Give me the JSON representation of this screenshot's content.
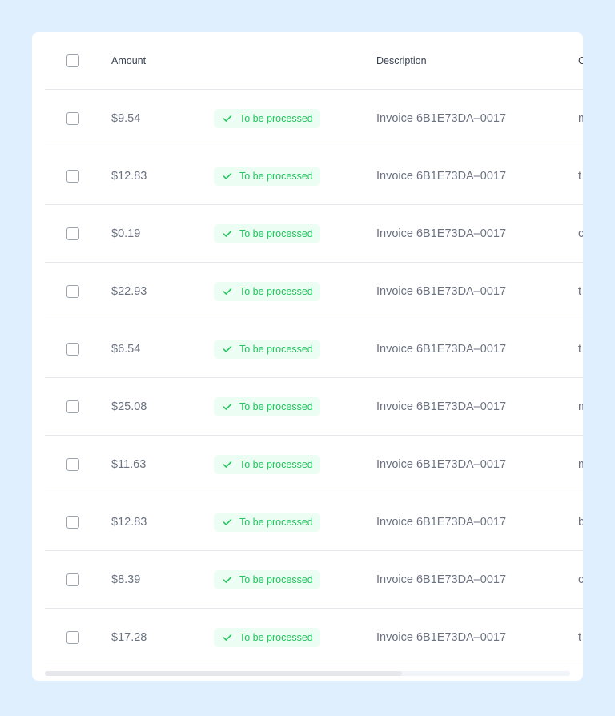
{
  "table": {
    "columns": {
      "amount": "Amount",
      "status": "",
      "description": "Description",
      "extra": "C"
    },
    "rows": [
      {
        "amount": "$9.54",
        "status": "To be processed",
        "description": "Invoice 6B1E73DA–0017",
        "extra": "m"
      },
      {
        "amount": "$12.83",
        "status": "To be processed",
        "description": "Invoice 6B1E73DA–0017",
        "extra": "t"
      },
      {
        "amount": "$0.19",
        "status": "To be processed",
        "description": "Invoice 6B1E73DA–0017",
        "extra": "c"
      },
      {
        "amount": "$22.93",
        "status": "To be processed",
        "description": "Invoice 6B1E73DA–0017",
        "extra": "t"
      },
      {
        "amount": "$6.54",
        "status": "To be processed",
        "description": "Invoice 6B1E73DA–0017",
        "extra": "t"
      },
      {
        "amount": "$25.08",
        "status": "To be processed",
        "description": "Invoice 6B1E73DA–0017",
        "extra": "m"
      },
      {
        "amount": "$11.63",
        "status": "To be processed",
        "description": "Invoice 6B1E73DA–0017",
        "extra": "m"
      },
      {
        "amount": "$12.83",
        "status": "To be processed",
        "description": "Invoice 6B1E73DA–0017",
        "extra": "b"
      },
      {
        "amount": "$8.39",
        "status": "To be processed",
        "description": "Invoice 6B1E73DA–0017",
        "extra": "c"
      },
      {
        "amount": "$17.28",
        "status": "To be processed",
        "description": "Invoice 6B1E73DA–0017",
        "extra": "t"
      }
    ]
  },
  "icons": {
    "status_icon": "check-icon",
    "checkbox": "checkbox"
  },
  "colors": {
    "background": "#e0effe",
    "badge_bg": "#ecfdf3",
    "badge_text": "#22c55e"
  },
  "scroll": {
    "horizontal_position": 0
  }
}
